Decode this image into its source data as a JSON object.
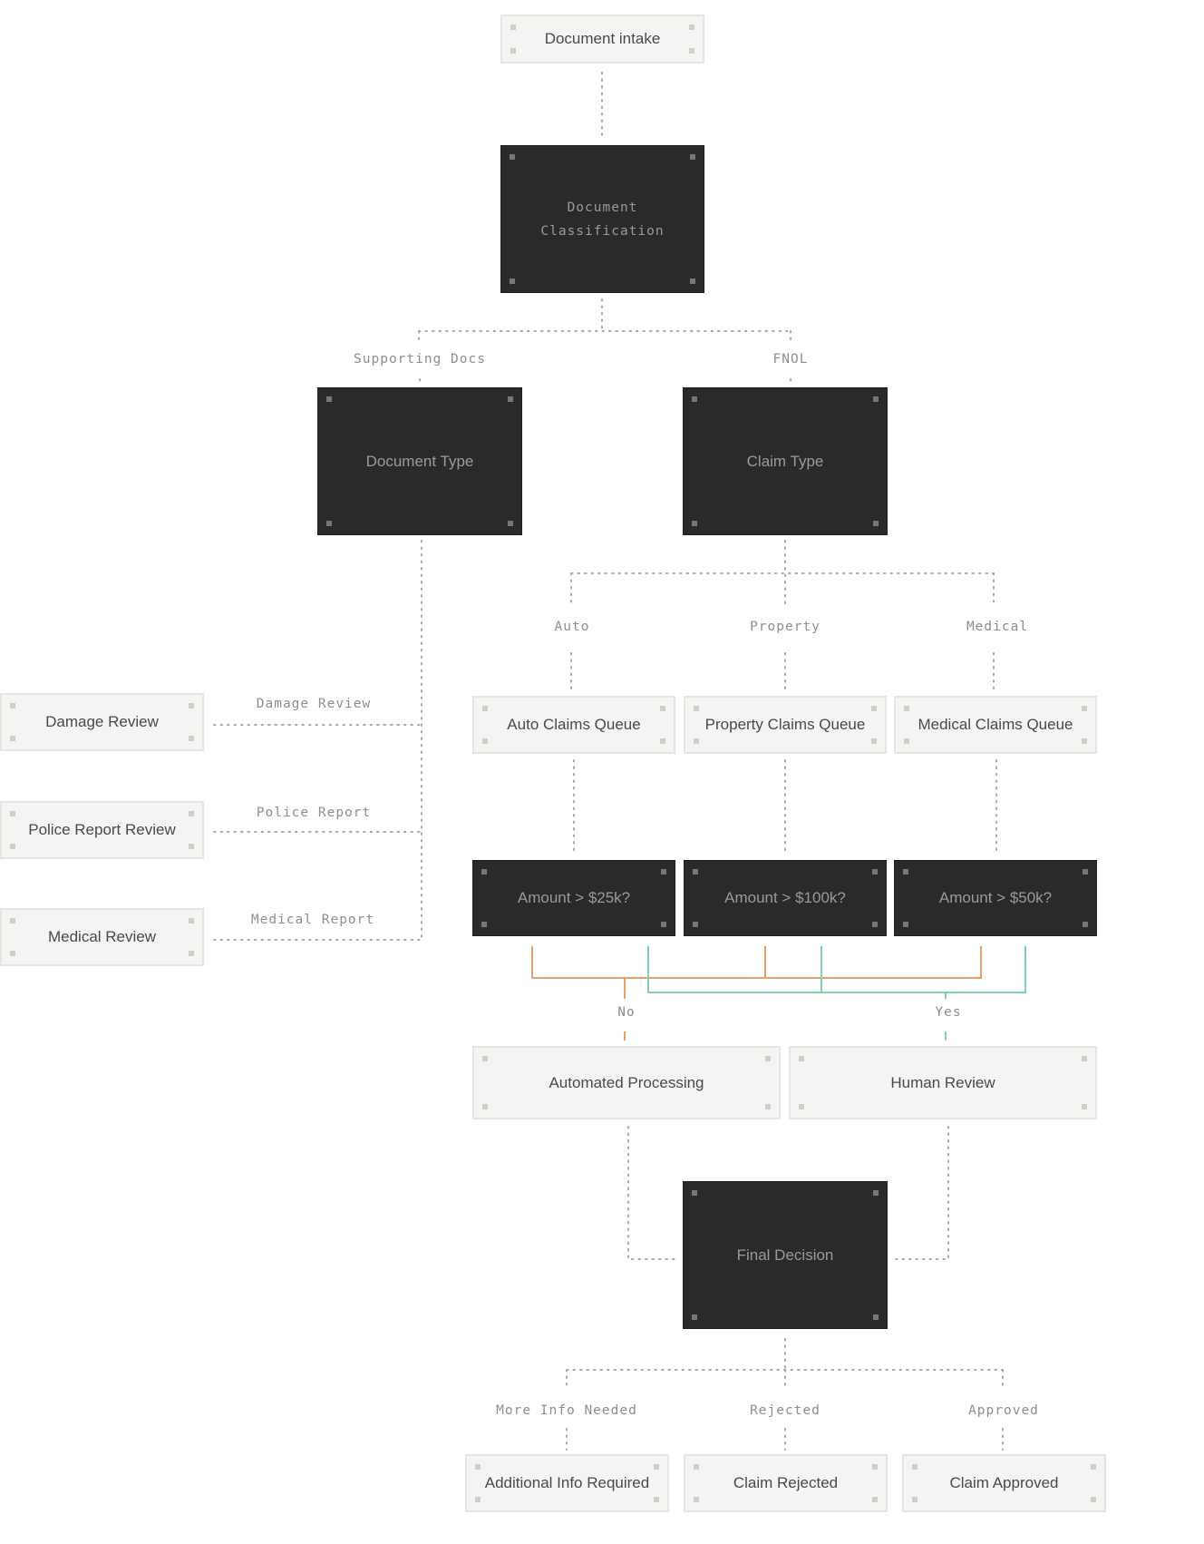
{
  "nodes": {
    "intake": "Document intake",
    "classification": "Document\nClassification",
    "document_type": "Document Type",
    "claim_type": "Claim Type",
    "damage_review": "Damage Review",
    "police_report_review": "Police Report Review",
    "medical_review": "Medical Review",
    "auto_queue": "Auto Claims Queue",
    "property_queue": "Property Claims Queue",
    "medical_queue": "Medical Claims Queue",
    "auto_amount": "Amount > $25k?",
    "property_amount": "Amount > $100k?",
    "medical_amount": "Amount > $50k?",
    "automated_processing": "Automated Processing",
    "human_review": "Human Review",
    "final_decision": "Final Decision",
    "additional_info": "Additional Info Required",
    "claim_rejected": "Claim Rejected",
    "claim_approved": "Claim Approved"
  },
  "edge_labels": {
    "supporting_docs": "Supporting Docs",
    "fnol": "FNOL",
    "damage_review": "Damage Review",
    "police_report": "Police Report",
    "medical_report": "Medical Report",
    "auto": "Auto",
    "property": "Property",
    "medical": "Medical",
    "no": "No",
    "yes": "Yes",
    "more_info": "More Info Needed",
    "rejected": "Rejected",
    "approved": "Approved"
  },
  "colors": {
    "no_path": "#e8a06a",
    "yes_path": "#7fd3a6",
    "dotted": "#a8a8a8",
    "dark_node": "#2a2a2a",
    "light_node": "#f5f4f2"
  }
}
